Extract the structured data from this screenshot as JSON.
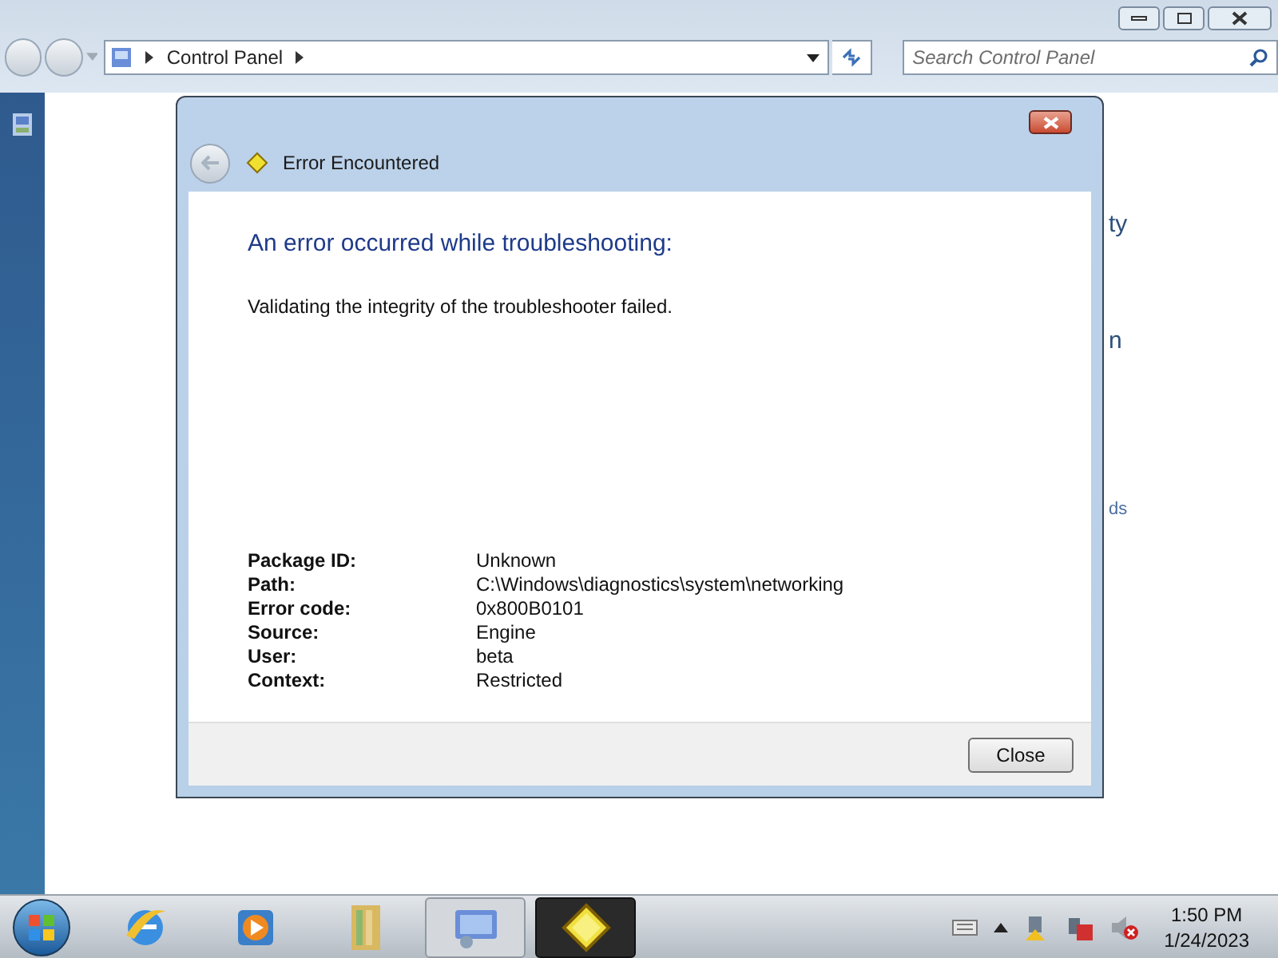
{
  "window": {
    "breadcrumb": "Control Panel",
    "search": {
      "placeholder": "Search Control Panel"
    }
  },
  "background_text": [
    "ty",
    "n",
    "ds"
  ],
  "dialog": {
    "title": "Error Encountered",
    "heading": "An error occurred while troubleshooting:",
    "message": "Validating the integrity of the troubleshooter failed.",
    "details": [
      {
        "label": "Package ID:",
        "value": "Unknown"
      },
      {
        "label": "Path:",
        "value": "C:\\Windows\\diagnostics\\system\\networking"
      },
      {
        "label": "Error code:",
        "value": "0x800B0101"
      },
      {
        "label": "Source:",
        "value": "Engine"
      },
      {
        "label": "User:",
        "value": "beta"
      },
      {
        "label": "Context:",
        "value": "Restricted"
      }
    ],
    "buttons": [
      "Close"
    ]
  },
  "taskbar": {
    "apps": [
      {
        "kind": "browser",
        "open": false,
        "selected": false
      },
      {
        "kind": "media",
        "open": false,
        "selected": false
      },
      {
        "kind": "library",
        "open": false,
        "selected": false
      },
      {
        "kind": "control-panel",
        "open": true,
        "selected": false
      },
      {
        "kind": "troubleshooter",
        "open": true,
        "selected": true
      }
    ],
    "clock": {
      "time": "1:50 PM",
      "date": "1/24/2023"
    }
  }
}
